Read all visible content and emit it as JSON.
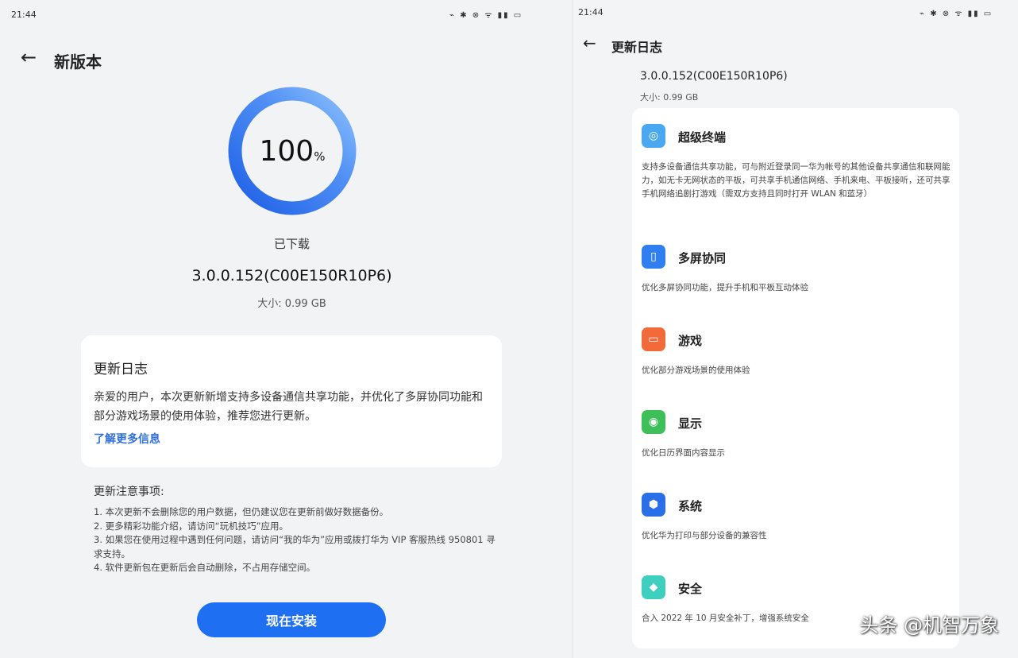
{
  "left": {
    "status_time": "21:44",
    "status_icons": "⌁ ✱ ⊗ ᯤ ▮▮ ▭",
    "title": "新版本",
    "progress": {
      "percent_number": "100",
      "percent_sign": "%",
      "value": 1.0
    },
    "downloaded_label": "已下载",
    "version": "3.0.0.152(C00E150R10P6)",
    "size": "大小: 0.99 GB",
    "changelog": {
      "title": "更新日志",
      "body": "亲爱的用户，本次更新新增支持多设备通信共享功能，并优化了多屏协同功能和部分游戏场景的使用体验，推荐您进行更新。",
      "link": "了解更多信息"
    },
    "notes": {
      "title": "更新注意事项:",
      "items": [
        "1. 本次更新不会删除您的用户数据，但仍建议您在更新前做好数据备份。",
        "2. 更多精彩功能介绍，请访问“玩机技巧”应用。",
        "3. 如果您在使用过程中遇到任何问题，请访问“我的华为”应用或拨打华为 VIP 客服热线 950801 寻求支持。",
        "4. 软件更新包在更新后会自动删除，不占用存储空间。"
      ]
    },
    "install_button": "现在安装"
  },
  "right": {
    "status_time": "21:44",
    "status_icons": "⌁ ✱ ⊗ ᯤ ▮▮ ▭",
    "title": "更新日志",
    "version": "3.0.0.152(C00E150R10P6)",
    "size": "大小: 0.99 GB",
    "items": [
      {
        "name": "超级终端",
        "icon": "super-device-icon",
        "color": "#4aa8f0",
        "glyph": "◎",
        "desc": "支持多设备通信共享功能，可与附近登录同一华为帐号的其他设备共享通信和联网能力，如无卡无网状态的平板，可共享手机通信网络、手机来电、平板接听，还可共享手机网络追剧打游戏（需双方支持且同时打开 WLAN 和蓝牙）"
      },
      {
        "name": "多屏协同",
        "icon": "multi-screen-icon",
        "color": "#2f7ff0",
        "glyph": "▯",
        "desc": "优化多屏协同功能，提升手机和平板互动体验"
      },
      {
        "name": "游戏",
        "icon": "game-icon",
        "color": "#f26a3a",
        "glyph": "▭",
        "desc": "优化部分游戏场景的使用体验"
      },
      {
        "name": "显示",
        "icon": "display-icon",
        "color": "#3fbf5a",
        "glyph": "◉",
        "desc": "优化日历界面内容显示"
      },
      {
        "name": "系统",
        "icon": "system-icon",
        "color": "#2b6fe8",
        "glyph": "⬢",
        "desc": "优化华为打印与部分设备的兼容性"
      },
      {
        "name": "安全",
        "icon": "security-icon",
        "color": "#3fcfbf",
        "glyph": "◆",
        "desc": "合入 2022 年 10 月安全补丁，增强系统安全"
      }
    ]
  },
  "watermark": "头条 @机智万象"
}
